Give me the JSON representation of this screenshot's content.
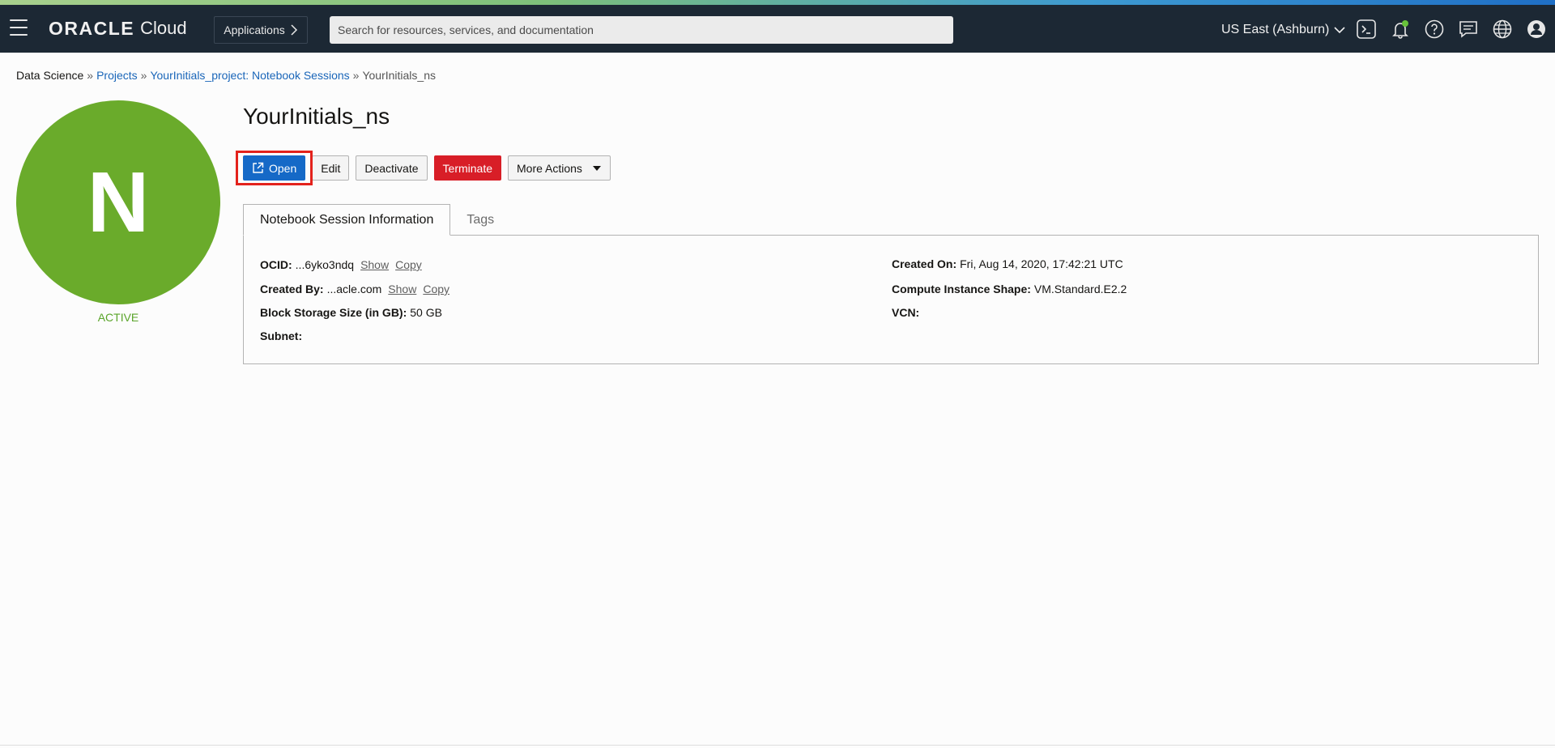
{
  "header": {
    "brand_oracle": "ORACLE",
    "brand_cloud": "Cloud",
    "applications_label": "Applications",
    "search_placeholder": "Search for resources, services, and documentation",
    "region_label": "US East (Ashburn)"
  },
  "breadcrumb": {
    "root": "Data Science",
    "projects": "Projects",
    "project": "YourInitials_project: Notebook Sessions",
    "current": "YourInitials_ns",
    "separator": "»"
  },
  "resource": {
    "avatar_letter": "N",
    "status": "ACTIVE",
    "title": "YourInitials_ns"
  },
  "actions": {
    "open": "Open",
    "edit": "Edit",
    "deactivate": "Deactivate",
    "terminate": "Terminate",
    "more_actions": "More Actions"
  },
  "tabs": {
    "info": "Notebook Session Information",
    "tags": "Tags"
  },
  "details": {
    "ocid_label": "OCID:",
    "ocid_value": "...6yko3ndq",
    "created_by_label": "Created By:",
    "created_by_value": "...acle.com",
    "block_storage_label": "Block Storage Size (in GB):",
    "block_storage_value": "50 GB",
    "subnet_label": "Subnet:",
    "subnet_value": "",
    "created_on_label": "Created On:",
    "created_on_value": "Fri, Aug 14, 2020, 17:42:21 UTC",
    "shape_label": "Compute Instance Shape:",
    "shape_value": "VM.Standard.E2.2",
    "vcn_label": "VCN:",
    "vcn_value": "",
    "show_link": "Show",
    "copy_link": "Copy"
  },
  "colors": {
    "topbar": "#1c2834",
    "avatar": "#6aab2b",
    "primary": "#1569c7",
    "danger": "#d81e27",
    "highlight": "#e3221c",
    "link": "#1a66b9"
  },
  "icons": [
    "hamburger-icon",
    "chevron-right-icon",
    "chevron-down-icon",
    "cloud-shell-icon",
    "bell-icon",
    "help-icon",
    "chat-icon",
    "globe-icon",
    "user-icon",
    "external-link-icon",
    "caret-down-icon"
  ]
}
